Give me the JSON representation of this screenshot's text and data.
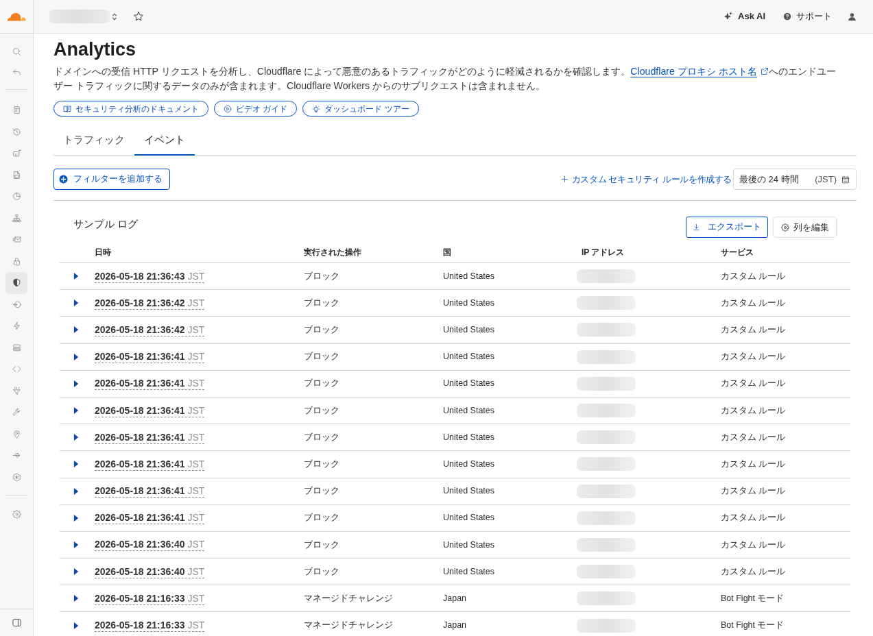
{
  "top_bar": {
    "ask_ai_label": "Ask AI",
    "support_label": "サポート"
  },
  "sidebar": {
    "groups": [
      {
        "items": [
          {
            "selected": false
          },
          {
            "selected": false
          },
          {
            "selected": false
          },
          {
            "selected": false
          },
          {
            "selected": false
          },
          {
            "selected": false
          },
          {
            "selected": false
          },
          {
            "selected": false
          },
          {
            "selected": true
          },
          {
            "selected": false
          },
          {
            "selected": false
          },
          {
            "selected": false
          },
          {
            "selected": false
          },
          {
            "selected": false
          },
          {
            "selected": false
          },
          {
            "selected": false
          },
          {
            "selected": false
          },
          {
            "selected": false
          }
        ]
      },
      {
        "items": [
          {
            "selected": false
          }
        ]
      }
    ]
  },
  "page": {
    "title": "Analytics",
    "description": {
      "before": "ドメインへの受信 HTTP リクエストを分析し、Cloudflare によって悪意のあるトラフィックがどのように軽減されるかを確認します。",
      "link": "Cloudflare プロキシ ホスト名",
      "after": "へのエンドユーザー トラフィックに関するデータのみが含まれます。Cloudflare Workers からのサブリクエストは含まれません。"
    },
    "resource_buttons": [
      {
        "label": "セキュリティ分析のドキュメント"
      },
      {
        "label": "ビデオ ガイド"
      },
      {
        "label": "ダッシュボード ツアー"
      }
    ]
  },
  "tabs": [
    {
      "label": "トラフィック",
      "selected": false
    },
    {
      "label": "イベント",
      "selected": true
    }
  ],
  "filter_bar": {
    "add_filter_label": "フィルターを追加する",
    "create_rule_label": "カスタム セキュリティ ルールを作成する",
    "time_range": {
      "value": "最後の 24 時間",
      "timezone": "(JST)"
    }
  },
  "sample_log": {
    "title": "サンプル ログ",
    "export_label": "エクスポート",
    "edit_columns_label": "列を編集",
    "columns": [
      "日時",
      "実行された操作",
      "国",
      "IP アドレス",
      "サービス"
    ],
    "rows": [
      {
        "expanded": false,
        "datetime": "2026-05-18 21:36:43",
        "timezone": "JST",
        "action": "ブロック",
        "country": "United States",
        "service": "カスタム ルール"
      },
      {
        "expanded": false,
        "datetime": "2026-05-18 21:36:42",
        "timezone": "JST",
        "action": "ブロック",
        "country": "United States",
        "service": "カスタム ルール"
      },
      {
        "expanded": false,
        "datetime": "2026-05-18 21:36:42",
        "timezone": "JST",
        "action": "ブロック",
        "country": "United States",
        "service": "カスタム ルール"
      },
      {
        "expanded": false,
        "datetime": "2026-05-18 21:36:41",
        "timezone": "JST",
        "action": "ブロック",
        "country": "United States",
        "service": "カスタム ルール"
      },
      {
        "expanded": false,
        "datetime": "2026-05-18 21:36:41",
        "timezone": "JST",
        "action": "ブロック",
        "country": "United States",
        "service": "カスタム ルール"
      },
      {
        "expanded": false,
        "datetime": "2026-05-18 21:36:41",
        "timezone": "JST",
        "action": "ブロック",
        "country": "United States",
        "service": "カスタム ルール"
      },
      {
        "expanded": false,
        "datetime": "2026-05-18 21:36:41",
        "timezone": "JST",
        "action": "ブロック",
        "country": "United States",
        "service": "カスタム ルール"
      },
      {
        "expanded": false,
        "datetime": "2026-05-18 21:36:41",
        "timezone": "JST",
        "action": "ブロック",
        "country": "United States",
        "service": "カスタム ルール"
      },
      {
        "expanded": false,
        "datetime": "2026-05-18 21:36:41",
        "timezone": "JST",
        "action": "ブロック",
        "country": "United States",
        "service": "カスタム ルール"
      },
      {
        "expanded": false,
        "datetime": "2026-05-18 21:36:41",
        "timezone": "JST",
        "action": "ブロック",
        "country": "United States",
        "service": "カスタム ルール"
      },
      {
        "expanded": false,
        "datetime": "2026-05-18 21:36:40",
        "timezone": "JST",
        "action": "ブロック",
        "country": "United States",
        "service": "カスタム ルール"
      },
      {
        "expanded": false,
        "datetime": "2026-05-18 21:36:40",
        "timezone": "JST",
        "action": "ブロック",
        "country": "United States",
        "service": "カスタム ルール"
      },
      {
        "expanded": false,
        "datetime": "2026-05-18 21:16:33",
        "timezone": "JST",
        "action": "マネージドチャレンジ",
        "country": "Japan",
        "service": "Bot Fight モード"
      },
      {
        "expanded": false,
        "datetime": "2026-05-18 21:16:33",
        "timezone": "JST",
        "action": "マネージドチャレンジ",
        "country": "Japan",
        "service": "Bot Fight モード"
      }
    ]
  }
}
